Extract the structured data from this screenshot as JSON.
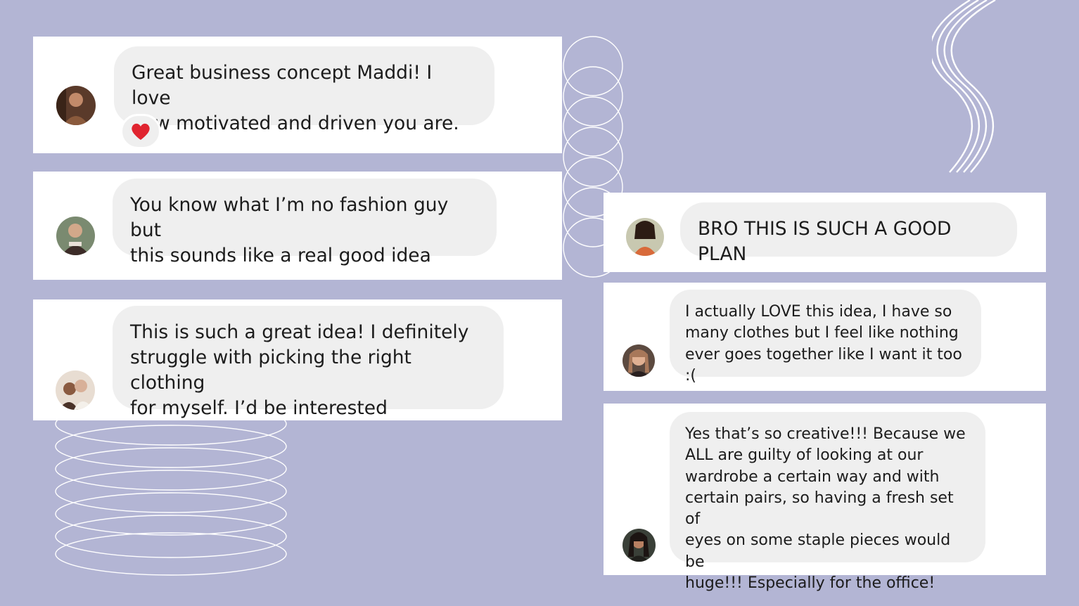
{
  "colors": {
    "background": "#b3b5d4",
    "card": "#ffffff",
    "bubble": "#efefef",
    "text": "#1c1c1c",
    "heart": "#e0242f"
  },
  "comments": [
    {
      "text": "Great business concept Maddi! I love\nhow motivated and driven you are.",
      "reaction": "heart-icon"
    },
    {
      "text": "You know what I’m no fashion guy but\nthis sounds like a real good idea"
    },
    {
      "text": "This is such a great idea! I definitely\nstruggle with picking the right clothing\nfor myself. I’d be interested"
    },
    {
      "text": "BRO THIS IS SUCH A GOOD PLAN"
    },
    {
      "text": "I actually LOVE this idea, I have so\nmany clothes but I feel like nothing\never goes together like I want it too :("
    },
    {
      "text": "Yes that’s so creative!!! Because we\nALL are guilty of looking at our\nwardrobe a certain way and with\ncertain pairs, so having a fresh set of\neyes on some staple pieces would be\nhuge!!! Especially for the office!"
    }
  ]
}
